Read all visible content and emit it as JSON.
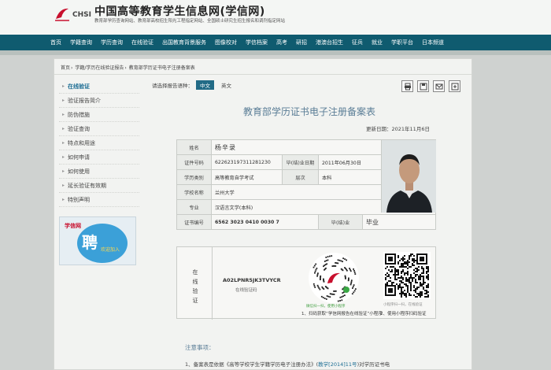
{
  "header": {
    "logo_text": "CHSI",
    "title": "中国高等教育学生信息网(学信网)",
    "subtitle": "教育部学历查询网站、教育部高校招生阳光工程指定网站、全国硕士研究生招生报名和调剂指定网站"
  },
  "nav": {
    "items": [
      "首页",
      "学籍查询",
      "学历查询",
      "在线验证",
      "出国教育背景服务",
      "图像校对",
      "学信档案",
      "高考",
      "研招",
      "港澳台招生",
      "征兵",
      "就业",
      "学职平台",
      "日本频道"
    ]
  },
  "breadcrumb": [
    "首页",
    "学籍/学历在线验证报告",
    "教育部学历证书电子注册备案表"
  ],
  "sidebar": {
    "items": [
      "在线验证",
      "验证报告简介",
      "防伪措施",
      "验证查询",
      "特点和用途",
      "如何申请",
      "如何使用",
      "延长验证有效期",
      "特别声明"
    ],
    "ad": {
      "logo": "学信网",
      "big": "聘",
      "small": "欢迎加入"
    }
  },
  "language": {
    "prompt": "请选择报告语种：",
    "options": [
      "中文",
      "英文"
    ],
    "selected": "中文"
  },
  "toolbar": {
    "icons": [
      "print-icon",
      "save-icon",
      "mail-icon",
      "share-icon"
    ]
  },
  "document": {
    "title": "教育部学历证书电子注册备案表",
    "update_date": "更新日期：2021年11月6日",
    "rows": {
      "name_label": "姓名",
      "name_value": "杨辛录",
      "cert_label": "证件号码",
      "cert_value": "622623197311281230",
      "grad_date_label": "毕(结)业日期",
      "grad_date_value": "2011年06月30日",
      "type_label": "学历类别",
      "type_value": "高等教育自学考试",
      "level_label": "层次",
      "level_value": "本科",
      "school_label": "学校名称",
      "school_value": "兰州大学",
      "major_label": "专业",
      "major_value": "汉语言文学(本科)",
      "certno_label": "证书编号",
      "certno_value": "6562 3023 0410 0030 7",
      "grad_label": "毕(结)业",
      "grad_value": "毕业"
    },
    "verify": {
      "label": "在线验证",
      "code": "A02LPNR5JK3TVYCR",
      "code_caption": "在线验证码",
      "mini_caption": "微信扫一扫，使用小程序",
      "mini_step": "1、扫码获取“学信网报告在线验证”小程序",
      "qr_caption": "小程序扫一扫，在线验证",
      "qr_step": "2、使用小程序扫码验证"
    },
    "notes": {
      "title": "注意事项：",
      "line1_prefix": "1、备案表是依据《高等学校学生学籍学历电子注册办法》(",
      "line1_link": "教学[2014]11号",
      "line1_suffix": ")对学历证书电"
    }
  }
}
